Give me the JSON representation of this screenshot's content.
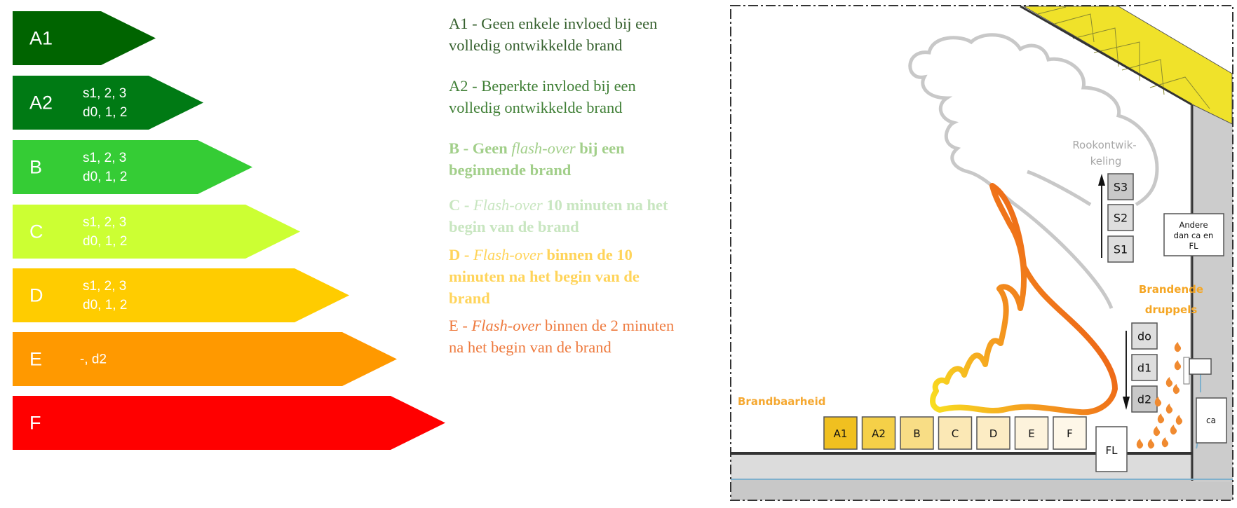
{
  "classes": [
    {
      "label": "A1",
      "sub": "",
      "color": "#006400"
    },
    {
      "label": "A2",
      "sub": "s1, 2, 3\nd0, 1, 2",
      "color": "#007a14"
    },
    {
      "label": "B",
      "sub": "s1, 2, 3\nd0, 1, 2",
      "color": "#35cc35"
    },
    {
      "label": "C",
      "sub": "s1, 2, 3\nd0, 1, 2",
      "color": "#ccff33"
    },
    {
      "label": "D",
      "sub": "s1, 2, 3\nd0, 1, 2",
      "color": "#ffcc00"
    },
    {
      "label": "E",
      "sub": "-, d2",
      "color": "#ff9900"
    },
    {
      "label": "F",
      "sub": "",
      "color": "#ff0000"
    }
  ],
  "descriptions": [
    {
      "color": "#345f2c",
      "bold": false,
      "lines": [
        [
          {
            "t": "A1 - Geen enkele invloed bij een"
          }
        ],
        [
          {
            "t": "volledig ontwikkelde brand"
          }
        ]
      ]
    },
    {
      "color": "#3f7f35",
      "bold": false,
      "lines": [
        [
          {
            "t": "A2 - Beperkte invloed bij een"
          }
        ],
        [
          {
            "t": "volledig ontwikkelde brand"
          }
        ]
      ]
    },
    {
      "color": "#a2cf8a",
      "bold": true,
      "lines": [
        [
          {
            "t": "B - Geen "
          },
          {
            "t": "flash-over",
            "i": true
          },
          {
            "t": " bij een"
          }
        ],
        [
          {
            "t": "beginnende brand"
          }
        ]
      ]
    },
    {
      "color": "#c8e6c0",
      "bold": true,
      "lines": [
        [
          {
            "t": "C - "
          },
          {
            "t": "Flash-over",
            "i": true
          },
          {
            "t": " 10 minuten na het"
          }
        ],
        [
          {
            "t": "begin van de brand"
          }
        ]
      ]
    },
    {
      "color": "#ffd45a",
      "bold": true,
      "lines": [
        [
          {
            "t": "D - "
          },
          {
            "t": "Flash-over",
            "i": true
          },
          {
            "t": " binnen de 10"
          }
        ],
        [
          {
            "t": "minuten na het begin van de"
          }
        ],
        [
          {
            "t": "brand"
          }
        ]
      ]
    },
    {
      "color": "#ee7a3e",
      "bold": false,
      "lines": [
        [
          {
            "t": "E - "
          },
          {
            "t": "Flash-over",
            "i": true
          },
          {
            "t": " binnen de 2 minuten"
          }
        ],
        [
          {
            "t": "na het begin van de brand"
          }
        ]
      ]
    }
  ],
  "diagram": {
    "smoke_label_1": "Rookontwik-",
    "smoke_label_2": "keling",
    "smoke_classes": [
      "S3",
      "S2",
      "S1"
    ],
    "droplets_label_1": "Brandende",
    "droplets_label_2": "druppels",
    "droplet_classes": [
      "do",
      "d1",
      "d2"
    ],
    "combustibility_label": "Brandbaarheid",
    "floor_classes": [
      {
        "label": "A1",
        "color": "#f0c020"
      },
      {
        "label": "A2",
        "color": "#f5d048"
      },
      {
        "label": "B",
        "color": "#f8dd85"
      },
      {
        "label": "C",
        "color": "#fbe8b5"
      },
      {
        "label": "D",
        "color": "#fcecc4"
      },
      {
        "label": "E",
        "color": "#fdf3dc"
      },
      {
        "label": "F",
        "color": "#fef7e8"
      }
    ],
    "fl_label": "FL",
    "other_label_1": "Andere",
    "other_label_2": "dan ca en",
    "other_label_3": "FL",
    "ca_label": "ca"
  }
}
